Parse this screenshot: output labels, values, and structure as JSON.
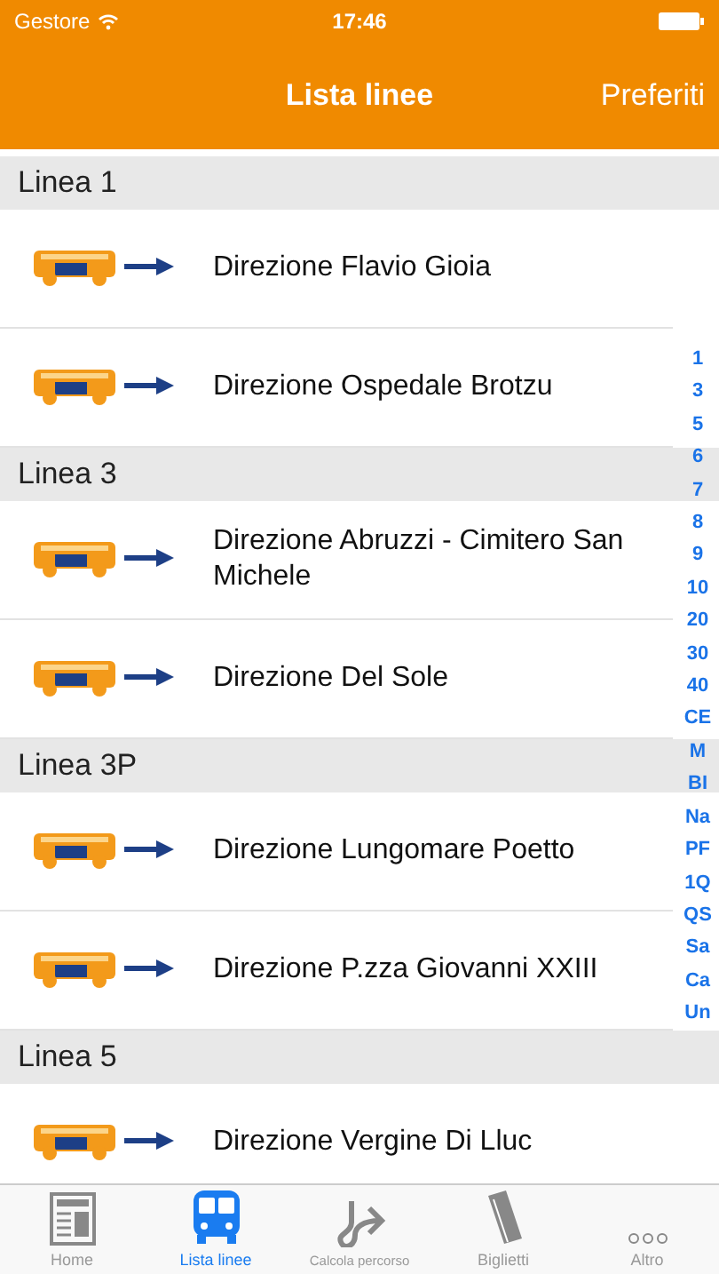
{
  "status_bar": {
    "carrier": "Gestore",
    "time": "17:46"
  },
  "nav_bar": {
    "title": "Lista linee",
    "right_button": "Preferiti"
  },
  "sections": [
    {
      "title": "Linea 1",
      "rows": [
        {
          "label": "Direzione Flavio Gioia"
        },
        {
          "label": "Direzione Ospedale Brotzu"
        }
      ]
    },
    {
      "title": "Linea 3",
      "rows": [
        {
          "label": "Direzione Abruzzi - Cimitero San Michele"
        },
        {
          "label": "Direzione Del Sole"
        }
      ]
    },
    {
      "title": "Linea 3P",
      "rows": [
        {
          "label": "Direzione Lungomare Poetto"
        },
        {
          "label": "Direzione P.zza Giovanni XXIII"
        }
      ]
    },
    {
      "title": "Linea 5",
      "rows": [
        {
          "label": "Direzione Vergine Di Lluc"
        }
      ]
    }
  ],
  "section_index": [
    "1",
    "3",
    "5",
    "6",
    "7",
    "8",
    "9",
    "10",
    "20",
    "30",
    "40",
    "CE",
    "M",
    "BI",
    "Na",
    "PF",
    "1Q",
    "QS",
    "Sa",
    "Ca",
    "Un"
  ],
  "tab_bar": [
    {
      "label": "Home",
      "kind": "news",
      "selected": false
    },
    {
      "label": "Lista linee",
      "kind": "bus",
      "selected": true
    },
    {
      "label": "Calcola percorso",
      "kind": "route",
      "selected": false
    },
    {
      "label": "Biglietti",
      "kind": "ticket",
      "selected": false
    },
    {
      "label": "Altro",
      "kind": "more",
      "selected": false
    }
  ]
}
